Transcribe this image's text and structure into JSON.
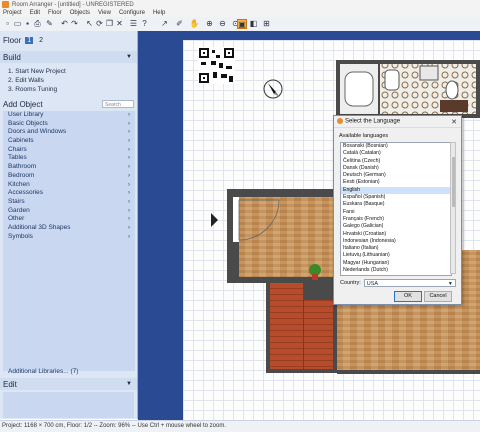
{
  "window": {
    "title": "Room Arranger - [untitled] - UNREGISTERED"
  },
  "menu": [
    "Project",
    "Edit",
    "Floor",
    "Objects",
    "View",
    "Configure",
    "Help"
  ],
  "toolbar_icons": [
    "new-icon",
    "open-icon",
    "save-icon",
    "print-icon",
    "paint-icon",
    "undo-icon",
    "redo-icon",
    "select-icon",
    "rotate-icon",
    "duplicate-icon",
    "delete-icon",
    "properties-icon",
    "help-icon",
    "zoom-in-icon",
    "zoom-out-icon",
    "zoom-fit-icon",
    "view-2d-icon",
    "view-3d-icon",
    "ruler-icon"
  ],
  "floor": {
    "label": "Floor",
    "tabs": [
      "1",
      "2"
    ]
  },
  "build": {
    "label": "Build",
    "items": [
      "1. Start New Project",
      "2. Edit Walls",
      "3. Rooms Tuning"
    ]
  },
  "add_object": {
    "label": "Add Object",
    "search_placeholder": "Search",
    "items": [
      "User Library",
      "Basic Objects",
      "Doors and Windows",
      "Cabinets",
      "Chairs",
      "Tables",
      "Bathroom",
      "Bedroom",
      "Kitchen",
      "Accessories",
      "Stairs",
      "Garden",
      "Other",
      "Additional 3D Shapes",
      "Symbols"
    ],
    "additional_libraries": "Additional Libraries... (7)"
  },
  "edit": {
    "label": "Edit"
  },
  "status": "Project: 1168 × 700 cm, Floor: 1/2 -- Zoom: 96% -- Use Ctrl + mouse wheel to zoom.",
  "dialog": {
    "title": "Select the Language",
    "available_label": "Available languages",
    "languages": [
      "Bosanski (Bosnian)",
      "Català (Catalan)",
      "Čeština (Czech)",
      "Dansk (Danish)",
      "Deutsch (German)",
      "Eesti (Estonian)",
      "English",
      "Español (Spanish)",
      "Euskara (Basque)",
      "Farsi",
      "Français (French)",
      "Galego (Galician)",
      "Hrvatski (Croatian)",
      "Indonesian (Indonesia)",
      "Italiano (Italian)",
      "Lietuvių (Lithuanian)",
      "Magyar (Hungarian)",
      "Nederlands (Dutch)"
    ],
    "selected": "English",
    "country_label": "Country:",
    "country_value": "USA",
    "ok": "OK",
    "cancel": "Cancel"
  },
  "colors": {
    "sidebar": "#dce6f5",
    "canvas_frame": "#2b4a94",
    "accent": "#3d6fb3",
    "selection": "#cde1fb"
  }
}
